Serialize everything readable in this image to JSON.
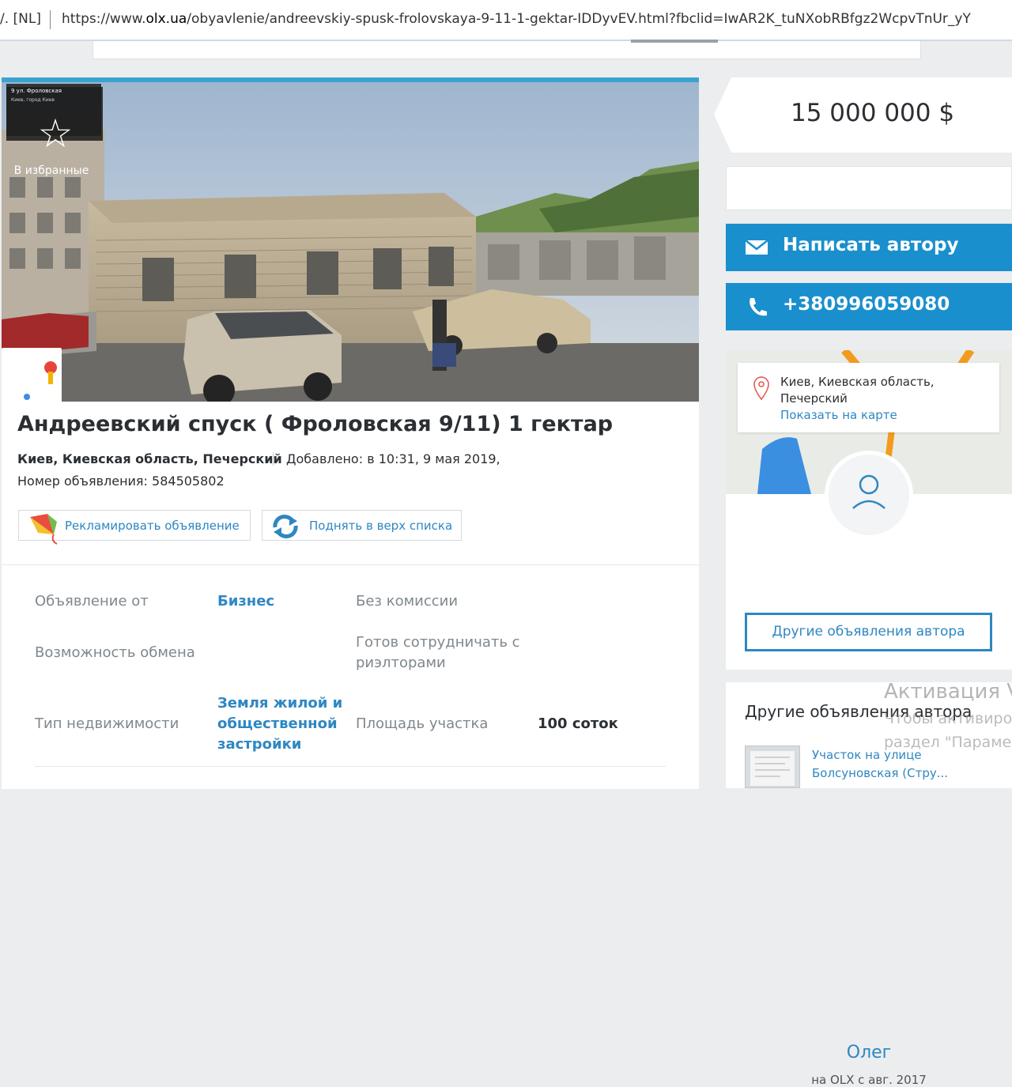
{
  "browser": {
    "cert_label": "/. [NL]",
    "url_prefix": "https://www.",
    "url_domain": "olx.ua",
    "url_rest": "/obyavlenie/andreevskiy-spusk-frolovskaya-9-11-1-gektar-IDDyvEV.html?fbclid=IwAR2K_tuNXobRBfgz2WcpvTnUr_yY"
  },
  "ad": {
    "favorite_label": "В избранные",
    "pano_street": "9 ул. Фроловская",
    "pano_city": "Киев, город Киев",
    "title": "Андреевский спуск ( Фроловская 9/11) 1 гектар",
    "location": "Киев, Киевская область, Печерский",
    "added": "Добавлено: в 10:31, 9 мая 2019,",
    "ad_number": "Номер объявления: 584505802",
    "promote_label": "Рекламировать объявление",
    "raise_label": "Поднять в верх списка"
  },
  "params": {
    "offer_from_label": "Объявление от",
    "offer_from_value": "Бизнес",
    "no_commission": "Без комиссии",
    "exchange_label": "Возможность обмена",
    "realtors_label_1": "Готов сотрудничать с",
    "realtors_label_2": "риэлторами",
    "property_type_label": "Тип недвижимости",
    "property_type_value_1": "Земля жилой и",
    "property_type_value_2": "общественной",
    "property_type_value_3": "застройки",
    "area_label": "Площадь участка",
    "area_value": "100 соток"
  },
  "sidebar": {
    "price": "15 000 000 $",
    "write_author": "Написать автору",
    "phone": "+380996059080",
    "map_address_1": "Киев, Киевская область,",
    "map_address_2": "Печерский",
    "map_link": "Показать на карте",
    "user_name": "Олег",
    "user_since": "на OLX с авг. 2017",
    "other_ads_button": "Другие объявления автора",
    "other_ads_title": "Другие объявления автора",
    "other_item_1": "Участок на улице",
    "other_item_2": "Болсуновская (Стру..."
  },
  "overlay": {
    "activation_1": "Активация V",
    "activation_2": "Чтобы активиро",
    "activation_3": "раздел \"Параме"
  },
  "colors": {
    "accent": "#1a8fcd",
    "link": "#2e87c2",
    "background": "#ebedee"
  }
}
